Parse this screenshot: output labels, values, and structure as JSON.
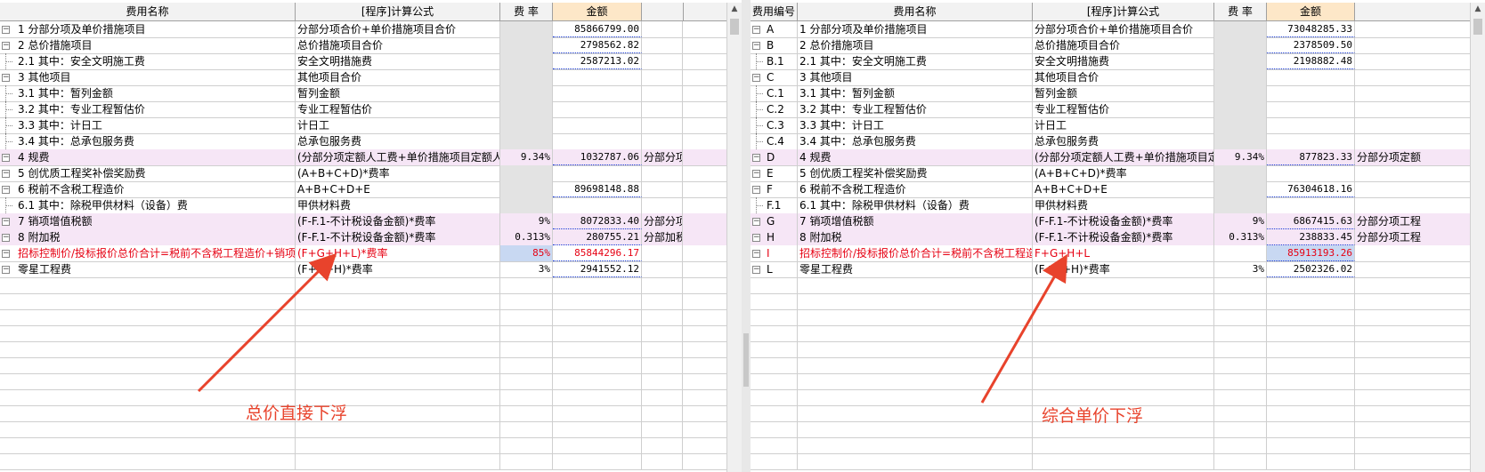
{
  "left": {
    "headers": {
      "name": "费用名称",
      "formula": "[程序]计算公式",
      "rate": "费 率",
      "amount": "金额"
    },
    "rows": [
      {
        "name": "1 分部分项及单价措施项目",
        "formula": "分部分项合价+单价措施项目合价",
        "rate": "",
        "amount": "85866799.00",
        "extra": "",
        "style": "",
        "node": "minus"
      },
      {
        "name": "2 总价措施项目",
        "formula": "总价措施项目合价",
        "rate": "",
        "amount": "2798562.82",
        "extra": "",
        "style": "",
        "node": "minus"
      },
      {
        "name": "2.1 其中：安全文明施工费",
        "formula": "安全文明措施费",
        "rate": "",
        "amount": "2587213.02",
        "extra": "",
        "style": "",
        "node": "leaf"
      },
      {
        "name": "3 其他项目",
        "formula": "其他项目合价",
        "rate": "",
        "amount": "",
        "extra": "",
        "style": "",
        "node": "minus"
      },
      {
        "name": "3.1 其中：暂列金额",
        "formula": "暂列金额",
        "rate": "",
        "amount": "",
        "extra": "",
        "style": "",
        "node": "leaf"
      },
      {
        "name": "3.2 其中：专业工程暂估价",
        "formula": "专业工程暂估价",
        "rate": "",
        "amount": "",
        "extra": "",
        "style": "",
        "node": "leaf"
      },
      {
        "name": "3.3 其中：计日工",
        "formula": "计日工",
        "rate": "",
        "amount": "",
        "extra": "",
        "style": "",
        "node": "leaf"
      },
      {
        "name": "3.4 其中：总承包服务费",
        "formula": "总承包服务费",
        "rate": "",
        "amount": "",
        "extra": "",
        "style": "",
        "node": "leaf"
      },
      {
        "name": "4 规费",
        "formula": "(分部分项定额人工费+单价措施项目定额人工",
        "rate": "9.34%",
        "amount": "1032787.06",
        "extra": "分部分项",
        "style": "pink",
        "node": "minus"
      },
      {
        "name": "5 创优质工程奖补偿奖励费",
        "formula": "(A+B+C+D)*费率",
        "rate": "",
        "amount": "",
        "extra": "",
        "style": "",
        "node": "minus"
      },
      {
        "name": "6 税前不含税工程造价",
        "formula": "A+B+C+D+E",
        "rate": "",
        "amount": "89698148.88",
        "extra": "",
        "style": "",
        "node": "minus"
      },
      {
        "name": "6.1 其中：除税甲供材料（设备）费",
        "formula": "甲供材料费",
        "rate": "",
        "amount": "",
        "extra": "",
        "style": "",
        "node": "leaf"
      },
      {
        "name": "7 销项增值税额",
        "formula": "(F-F.1-不计税设备金额)*费率",
        "rate": "9%",
        "amount": "8072833.40",
        "extra": "分部分项",
        "style": "pink",
        "node": "minus"
      },
      {
        "name": "8 附加税",
        "formula": "(F-F.1-不计税设备金额)*费率",
        "rate": "0.313%",
        "amount": "280755.21",
        "extra": "分部加税",
        "style": "pink",
        "node": "minus"
      },
      {
        "name": "招标控制价/投标报价总价合计=税前不含税工程造价+销项增值",
        "formula": "(F+G+H+L)*费率",
        "rate": "85%",
        "amount": "85844296.17",
        "extra": "",
        "style": "red",
        "node": "minus"
      },
      {
        "name": "零星工程费",
        "formula": "(F+G+H)*费率",
        "rate": "3%",
        "amount": "2941552.12",
        "extra": "",
        "style": "",
        "node": "minus"
      }
    ]
  },
  "right": {
    "headers": {
      "code": "费用编号",
      "name": "费用名称",
      "formula": "[程序]计算公式",
      "rate": "费 率",
      "amount": "金额"
    },
    "rows": [
      {
        "code": "A",
        "name": "1 分部分项及单价措施项目",
        "formula": "分部分项合价+单价措施项目合价",
        "rate": "",
        "amount": "73048285.33",
        "extra": "",
        "style": "",
        "node": "minus"
      },
      {
        "code": "B",
        "name": "2 总价措施项目",
        "formula": "总价措施项目合价",
        "rate": "",
        "amount": "2378509.50",
        "extra": "",
        "style": "",
        "node": "minus"
      },
      {
        "code": "B.1",
        "name": "2.1 其中：安全文明施工费",
        "formula": "安全文明措施费",
        "rate": "",
        "amount": "2198882.48",
        "extra": "",
        "style": "",
        "node": "leaf"
      },
      {
        "code": "C",
        "name": "3 其他项目",
        "formula": "其他项目合价",
        "rate": "",
        "amount": "",
        "extra": "",
        "style": "",
        "node": "minus"
      },
      {
        "code": "C.1",
        "name": "3.1 其中：暂列金额",
        "formula": "暂列金额",
        "rate": "",
        "amount": "",
        "extra": "",
        "style": "",
        "node": "leaf"
      },
      {
        "code": "C.2",
        "name": "3.2 其中：专业工程暂估价",
        "formula": "专业工程暂估价",
        "rate": "",
        "amount": "",
        "extra": "",
        "style": "",
        "node": "leaf"
      },
      {
        "code": "C.3",
        "name": "3.3 其中：计日工",
        "formula": "计日工",
        "rate": "",
        "amount": "",
        "extra": "",
        "style": "",
        "node": "leaf"
      },
      {
        "code": "C.4",
        "name": "3.4 其中：总承包服务费",
        "formula": "总承包服务费",
        "rate": "",
        "amount": "",
        "extra": "",
        "style": "",
        "node": "leaf"
      },
      {
        "code": "D",
        "name": "4 规费",
        "formula": "(分部分项定额人工费+单价措施项目定额",
        "rate": "9.34%",
        "amount": "877823.33",
        "extra": "分部分项定额",
        "style": "pink",
        "node": "minus"
      },
      {
        "code": "E",
        "name": "5 创优质工程奖补偿奖励费",
        "formula": "(A+B+C+D)*费率",
        "rate": "",
        "amount": "",
        "extra": "",
        "style": "",
        "node": "minus"
      },
      {
        "code": "F",
        "name": "6 税前不含税工程造价",
        "formula": "A+B+C+D+E",
        "rate": "",
        "amount": "76304618.16",
        "extra": "",
        "style": "",
        "node": "minus"
      },
      {
        "code": "F.1",
        "name": "6.1 其中：除税甲供材料（设备）费",
        "formula": "甲供材料费",
        "rate": "",
        "amount": "",
        "extra": "",
        "style": "",
        "node": "leaf"
      },
      {
        "code": "G",
        "name": "7 销项增值税额",
        "formula": "(F-F.1-不计税设备金额)*费率",
        "rate": "9%",
        "amount": "6867415.63",
        "extra": "分部分项工程",
        "style": "pink",
        "node": "minus"
      },
      {
        "code": "H",
        "name": "8 附加税",
        "formula": "(F-F.1-不计税设备金额)*费率",
        "rate": "0.313%",
        "amount": "238833.45",
        "extra": "分部分项工程",
        "style": "pink",
        "node": "minus"
      },
      {
        "code": "I",
        "name": "招标控制价/投标报价总价合计=税前不含税工程造价",
        "formula": "F+G+H+L",
        "rate": "",
        "amount": "85913193.26",
        "extra": "",
        "style": "red",
        "node": "minus"
      },
      {
        "code": "L",
        "name": "零星工程费",
        "formula": "(F+G+H)*费率",
        "rate": "3%",
        "amount": "2502326.02",
        "extra": "",
        "style": "",
        "node": "minus"
      }
    ]
  },
  "annotations": {
    "left": "总价直接下浮",
    "right": "综合单价下浮"
  },
  "colors": {
    "annotation": "#e8432c",
    "red_row_text": "#e60012",
    "pink_row": "#f6e6f6",
    "money_header": "#fde7c8",
    "underline": "#1a3cd6"
  }
}
